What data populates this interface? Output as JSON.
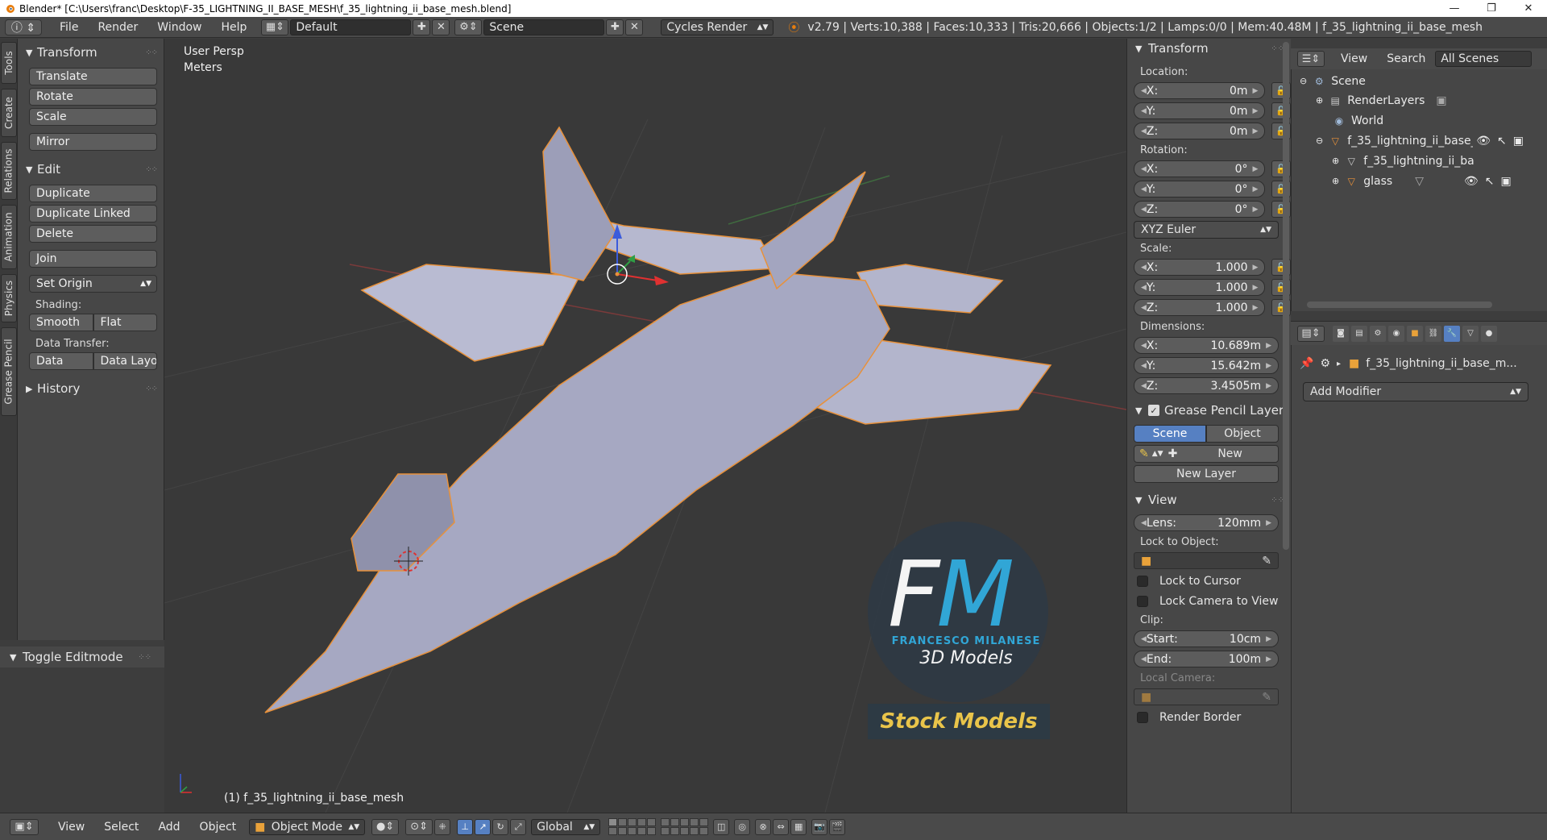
{
  "window": {
    "title": "Blender* [C:\\Users\\franc\\Desktop\\F-35_LIGHTNING_II_BASE_MESH\\f_35_lightning_ii_base_mesh.blend]",
    "minimize": "—",
    "maximize": "❐",
    "close": "✕"
  },
  "info_header": {
    "menus": [
      "File",
      "Render",
      "Window",
      "Help"
    ],
    "layout": "Default",
    "scene": "Scene",
    "engine": "Cycles Render",
    "stats": "v2.79 | Verts:10,388 | Faces:10,333 | Tris:20,666 | Objects:1/2 | Lamps:0/0 | Mem:40.48M | f_35_lightning_ii_base_mesh"
  },
  "vertical_tabs": [
    "Tools",
    "Create",
    "Relations",
    "Animation",
    "Physics",
    "Grease Pencil"
  ],
  "tool_shelf": {
    "transform_title": "Transform",
    "transform_buttons": [
      "Translate",
      "Rotate",
      "Scale"
    ],
    "mirror": "Mirror",
    "edit_title": "Edit",
    "edit_buttons": [
      "Duplicate",
      "Duplicate Linked",
      "Delete"
    ],
    "join": "Join",
    "set_origin": "Set Origin",
    "shading_label": "Shading:",
    "smooth": "Smooth",
    "flat": "Flat",
    "data_transfer_label": "Data Transfer:",
    "data": "Data",
    "data_layout": "Data Layo",
    "history_title": "History",
    "toggle_editmode": "Toggle Editmode"
  },
  "viewport": {
    "view_name": "User Persp",
    "units": "Meters",
    "object_name": "(1) f_35_lightning_ii_base_mesh",
    "watermark": {
      "letters_f": "F",
      "letters_m": "M",
      "brand": "FRANCESCO MILANESE",
      "subtitle": "3D Models",
      "stock": "Stock Models"
    }
  },
  "n_panel": {
    "transform_title": "Transform",
    "location_label": "Location:",
    "location": [
      {
        "axis": "X:",
        "value": "0m"
      },
      {
        "axis": "Y:",
        "value": "0m"
      },
      {
        "axis": "Z:",
        "value": "0m"
      }
    ],
    "rotation_label": "Rotation:",
    "rotation": [
      {
        "axis": "X:",
        "value": "0°"
      },
      {
        "axis": "Y:",
        "value": "0°"
      },
      {
        "axis": "Z:",
        "value": "0°"
      }
    ],
    "rotation_mode": "XYZ Euler",
    "scale_label": "Scale:",
    "scale": [
      {
        "axis": "X:",
        "value": "1.000"
      },
      {
        "axis": "Y:",
        "value": "1.000"
      },
      {
        "axis": "Z:",
        "value": "1.000"
      }
    ],
    "dimensions_label": "Dimensions:",
    "dimensions": [
      {
        "axis": "X:",
        "value": "10.689m"
      },
      {
        "axis": "Y:",
        "value": "15.642m"
      },
      {
        "axis": "Z:",
        "value": "3.4505m"
      }
    ],
    "grease_pencil_title": "Grease Pencil Layer",
    "gp_scene": "Scene",
    "gp_object": "Object",
    "gp_new": "New",
    "gp_new_layer": "New Layer",
    "view_title": "View",
    "lens_label": "Lens:",
    "lens_value": "120mm",
    "lock_to_object_label": "Lock to Object:",
    "lock_to_cursor": "Lock to Cursor",
    "lock_camera_to_view": "Lock Camera to View",
    "clip_label": "Clip:",
    "clip_start_label": "Start:",
    "clip_start_value": "10cm",
    "clip_end_label": "End:",
    "clip_end_value": "100m",
    "local_camera_label": "Local Camera:",
    "render_border": "Render Border"
  },
  "outliner": {
    "view": "View",
    "search": "Search",
    "filter": "All Scenes",
    "items": [
      {
        "label": "Scene"
      },
      {
        "label": "RenderLayers"
      },
      {
        "label": "World"
      },
      {
        "label": "f_35_lightning_ii_base_"
      },
      {
        "label": "f_35_lightning_ii_ba"
      },
      {
        "label": "glass"
      }
    ]
  },
  "properties": {
    "breadcrumb": "f_35_lightning_ii_base_m...",
    "add_modifier": "Add Modifier"
  },
  "bottom_header": {
    "menus": [
      "View",
      "Select",
      "Add",
      "Object"
    ],
    "mode": "Object Mode",
    "orientation": "Global"
  },
  "colors": {
    "accent": "#5680c2",
    "selection_outline": "#e8913a",
    "watermark_blue": "#31a6d6",
    "watermark_gold": "#e9c44a"
  }
}
